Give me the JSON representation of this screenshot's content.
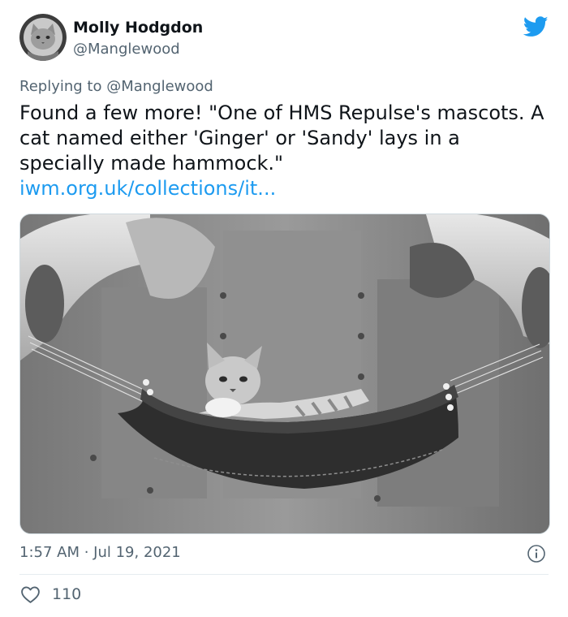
{
  "author": {
    "name": "Molly Hodgdon",
    "handle": "@Manglewood"
  },
  "reply": {
    "prefix": "Replying to ",
    "mention": "@Manglewood"
  },
  "tweet": {
    "text": "Found a few more! \"One of HMS Repulse's mascots. A cat named either 'Ginger' or 'Sandy' lays in a specially made hammock.\"",
    "link": "iwm.org.uk/collections/it..."
  },
  "meta": {
    "timestamp": "1:57 AM · Jul 19, 2021",
    "like_count": "110"
  },
  "icons": {
    "brand": "twitter-bird-icon",
    "info": "info-icon",
    "like": "heart-icon"
  },
  "colors": {
    "accent": "#1d9bf0",
    "muted": "#536471",
    "text": "#0f1419"
  }
}
